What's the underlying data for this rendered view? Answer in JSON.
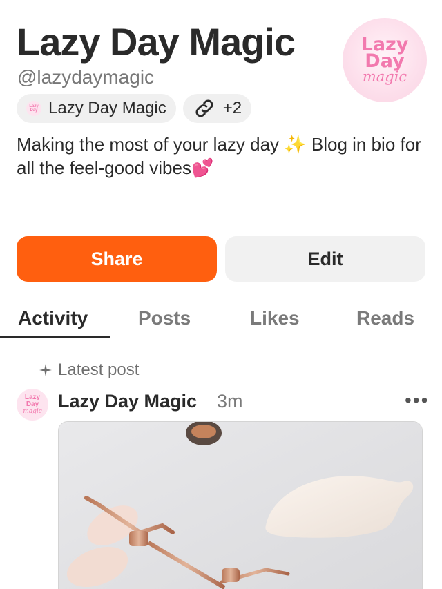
{
  "profile": {
    "name": "Lazy Day Magic",
    "handle": "@lazydaymagic",
    "avatar_lines": [
      "Lazy",
      "Day",
      "magic"
    ],
    "chip_name": "Lazy Day Magic",
    "chip_links": "+2",
    "bio": "Making the most of your lazy day ✨ Blog in bio for all the feel-good vibes💕"
  },
  "actions": {
    "share_label": "Share",
    "edit_label": "Edit"
  },
  "tabs": [
    {
      "label": "Activity",
      "active": true
    },
    {
      "label": "Posts",
      "active": false
    },
    {
      "label": "Likes",
      "active": false
    },
    {
      "label": "Reads",
      "active": false
    }
  ],
  "feed": {
    "section_label": "Latest post",
    "post": {
      "author": "Lazy Day Magic",
      "time": "3m",
      "more": "•••"
    }
  },
  "colors": {
    "accent": "#ff5f0f",
    "brand_pink": "#f279ae",
    "text_dark": "#2a2a2a",
    "text_muted": "#7a7a7a"
  },
  "icons": {
    "link": "link-icon",
    "sparkle": "sparkle-icon",
    "more": "more-icon"
  }
}
